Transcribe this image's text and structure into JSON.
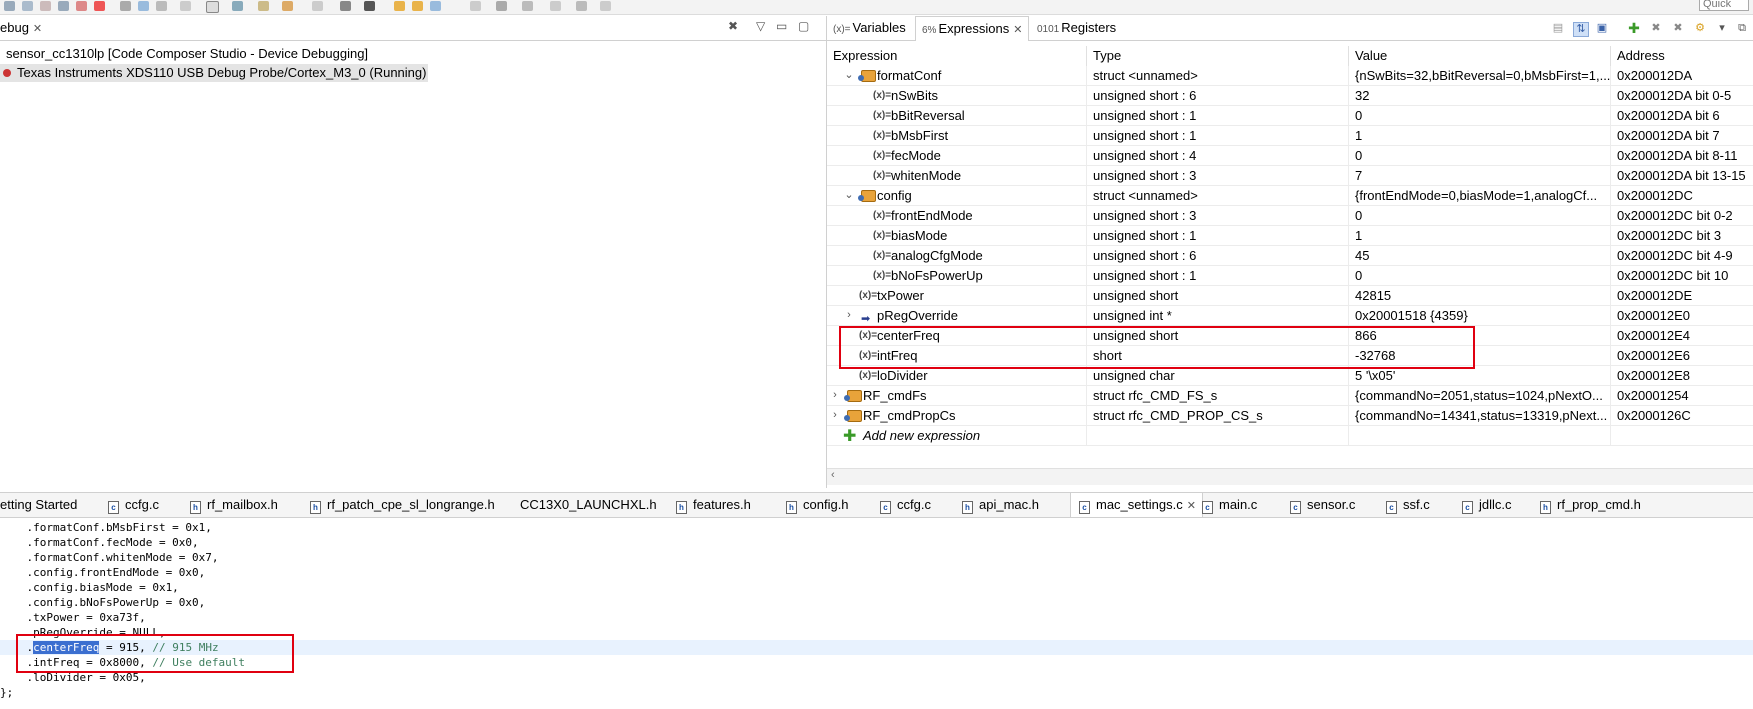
{
  "toolbar": {
    "quick_access": "Quick Access"
  },
  "debug": {
    "tab_label": "Debug",
    "tab_label_visible": "ebug",
    "session": "sensor_cc1310lp [Code Composer Studio - Device Debugging]",
    "target": "Texas Instruments XDS110 USB Debug Probe/Cortex_M3_0 (Running)"
  },
  "expressions": {
    "tabs": [
      {
        "label": "Variables",
        "icon": "variables-icon"
      },
      {
        "label": "Expressions",
        "icon": "expressions-icon"
      },
      {
        "label": "Registers",
        "icon": "registers-icon"
      }
    ],
    "columns": [
      "Expression",
      "Type",
      "Value",
      "Address"
    ],
    "rows": [
      {
        "name": "formatConf",
        "type": "struct <unnamed>",
        "value": "{nSwBits=32,bBitReversal=0,bMsbFirst=1,...",
        "address": "0x200012DA",
        "kind": "struct",
        "expanded": true
      },
      {
        "name": "nSwBits",
        "type": "unsigned short : 6",
        "value": "32",
        "address": "0x200012DA bit 0-5",
        "kind": "var"
      },
      {
        "name": "bBitReversal",
        "type": "unsigned short : 1",
        "value": "0",
        "address": "0x200012DA bit 6",
        "kind": "var"
      },
      {
        "name": "bMsbFirst",
        "type": "unsigned short : 1",
        "value": "1",
        "address": "0x200012DA bit 7",
        "kind": "var"
      },
      {
        "name": "fecMode",
        "type": "unsigned short : 4",
        "value": "0",
        "address": "0x200012DA bit 8-11",
        "kind": "var"
      },
      {
        "name": "whitenMode",
        "type": "unsigned short : 3",
        "value": "7",
        "address": "0x200012DA bit 13-15",
        "kind": "var"
      },
      {
        "name": "config",
        "type": "struct <unnamed>",
        "value": "{frontEndMode=0,biasMode=1,analogCf...",
        "address": "0x200012DC",
        "kind": "struct",
        "expanded": true
      },
      {
        "name": "frontEndMode",
        "type": "unsigned short : 3",
        "value": "0",
        "address": "0x200012DC bit 0-2",
        "kind": "var"
      },
      {
        "name": "biasMode",
        "type": "unsigned short : 1",
        "value": "1",
        "address": "0x200012DC bit 3",
        "kind": "var"
      },
      {
        "name": "analogCfgMode",
        "type": "unsigned short : 6",
        "value": "45",
        "address": "0x200012DC bit 4-9",
        "kind": "var"
      },
      {
        "name": "bNoFsPowerUp",
        "type": "unsigned short : 1",
        "value": "0",
        "address": "0x200012DC bit 10",
        "kind": "var"
      },
      {
        "name": "txPower",
        "type": "unsigned short",
        "value": "42815",
        "address": "0x200012DE",
        "kind": "var"
      },
      {
        "name": "pRegOverride",
        "type": "unsigned int *",
        "value": "0x20001518 {4359}",
        "address": "0x200012E0",
        "kind": "pointer"
      },
      {
        "name": "centerFreq",
        "type": "unsigned short",
        "value": "866",
        "address": "0x200012E4",
        "kind": "var"
      },
      {
        "name": "intFreq",
        "type": "short",
        "value": "-32768",
        "address": "0x200012E6",
        "kind": "var"
      },
      {
        "name": "loDivider",
        "type": "unsigned char",
        "value": "5 '\\x05'",
        "address": "0x200012E8",
        "kind": "var"
      },
      {
        "name": "RF_cmdFs",
        "type": "struct rfc_CMD_FS_s",
        "value": "{commandNo=2051,status=1024,pNextO...",
        "address": "0x20001254",
        "kind": "struct",
        "expanded": false
      },
      {
        "name": "RF_cmdPropCs",
        "type": "struct rfc_CMD_PROP_CS_s",
        "value": "{commandNo=14341,status=13319,pNext...",
        "address": "0x2000126C",
        "kind": "struct",
        "expanded": false
      }
    ],
    "add_new": "Add new expression",
    "var_icon_text": "(x)=",
    "highlight_color": "#e00010"
  },
  "editor": {
    "tabs": [
      {
        "label": "etting Started",
        "icon": ""
      },
      {
        "label": "ccfg.c",
        "icon": "c"
      },
      {
        "label": "rf_mailbox.h",
        "icon": "h"
      },
      {
        "label": "rf_patch_cpe_sl_longrange.h",
        "icon": "h"
      },
      {
        "label": "CC13X0_LAUNCHXL.h",
        "icon": ""
      },
      {
        "label": "features.h",
        "icon": "h"
      },
      {
        "label": "config.h",
        "icon": "h"
      },
      {
        "label": "ccfg.c",
        "icon": "c"
      },
      {
        "label": "api_mac.h",
        "icon": "h"
      },
      {
        "label": "mac_settings.c",
        "icon": "c",
        "active": true
      },
      {
        "label": "main.c",
        "icon": "c"
      },
      {
        "label": "sensor.c",
        "icon": "c"
      },
      {
        "label": "ssf.c",
        "icon": "c"
      },
      {
        "label": "jdllc.c",
        "icon": "c"
      },
      {
        "label": "rf_prop_cmd.h",
        "icon": "h"
      }
    ],
    "lines": [
      "    .formatConf.bMsbFirst = 0x1,",
      "    .formatConf.fecMode = 0x0,",
      "    .formatConf.whitenMode = 0x7,",
      "    .config.frontEndMode = 0x0,",
      "    .config.biasMode = 0x1,",
      "    .config.bNoFsPowerUp = 0x0,",
      "    .txPower = 0xa73f,",
      "    .pRegOverride = NULL,",
      "    .",
      "    .intFreq = 0x8000, ",
      "    .loDivider = 0x05,",
      "};"
    ],
    "center_sel": "centerFreq",
    "center_rest": " = 915, ",
    "center_comment": "// 915 MHz",
    "intfreq_comment": "// Use default"
  }
}
